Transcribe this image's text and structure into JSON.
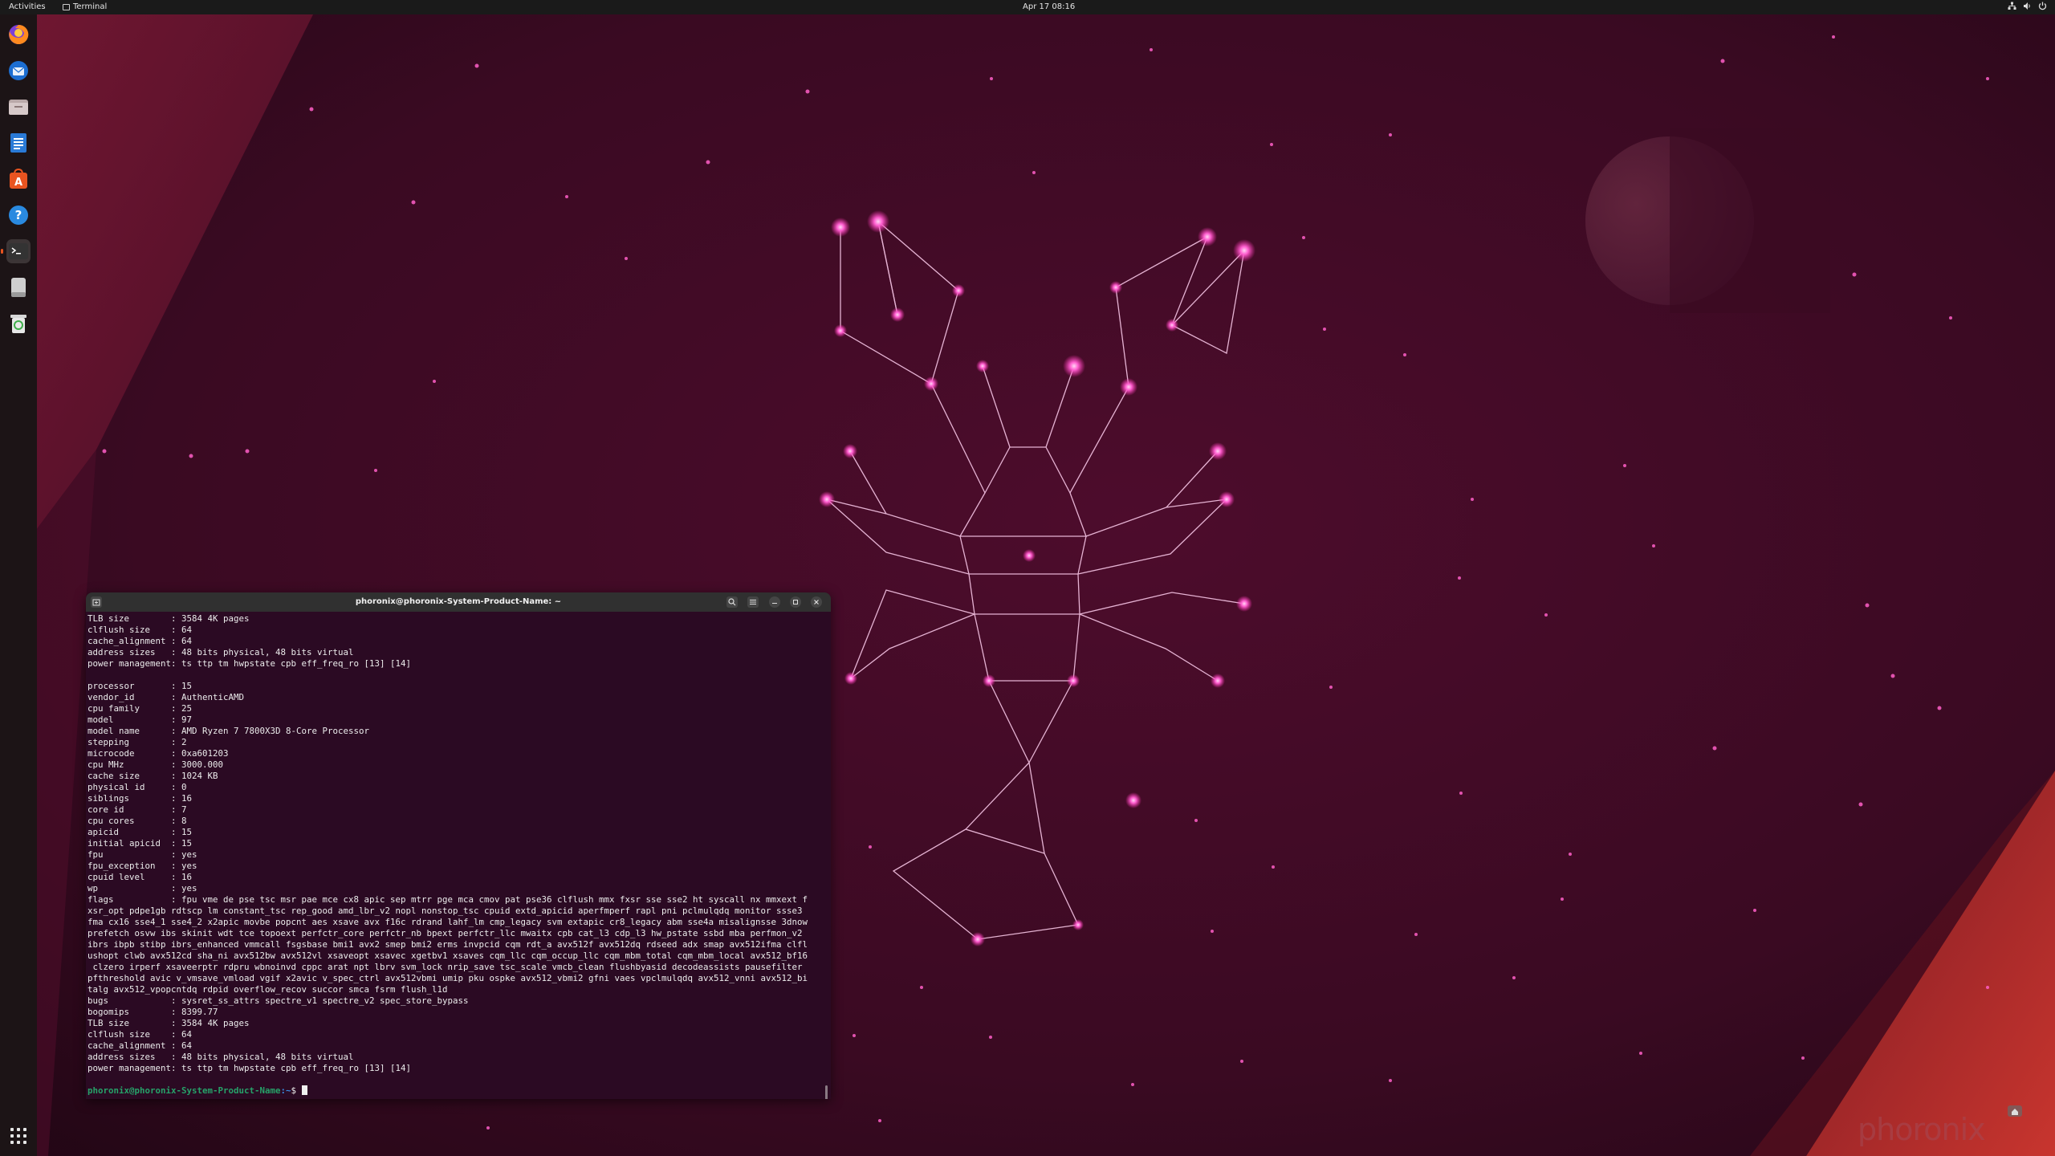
{
  "topbar": {
    "activities": "Activities",
    "app_name": "Terminal",
    "clock": "Apr 17  08:16"
  },
  "dock": {
    "items": [
      {
        "name": "firefox",
        "icon": "firefox-icon"
      },
      {
        "name": "thunderbird",
        "icon": "mail-icon"
      },
      {
        "name": "files",
        "icon": "folder-icon"
      },
      {
        "name": "writer",
        "icon": "document-icon"
      },
      {
        "name": "app-center",
        "icon": "store-icon"
      },
      {
        "name": "help",
        "icon": "help-icon"
      },
      {
        "name": "terminal",
        "icon": "terminal-icon",
        "active": true
      },
      {
        "name": "drive",
        "icon": "drive-icon"
      },
      {
        "name": "trash",
        "icon": "trash-icon"
      }
    ],
    "show_apps": "grid-icon"
  },
  "terminal": {
    "title": "phoronix@phoronix-System-Product-Name: ~",
    "lines": [
      "TLB size        : 3584 4K pages",
      "clflush size    : 64",
      "cache_alignment : 64",
      "address sizes   : 48 bits physical, 48 bits virtual",
      "power management: ts ttp tm hwpstate cpb eff_freq_ro [13] [14]",
      "",
      "processor       : 15",
      "vendor_id       : AuthenticAMD",
      "cpu family      : 25",
      "model           : 97",
      "model name      : AMD Ryzen 7 7800X3D 8-Core Processor",
      "stepping        : 2",
      "microcode       : 0xa601203",
      "cpu MHz         : 3000.000",
      "cache size      : 1024 KB",
      "physical id     : 0",
      "siblings        : 16",
      "core id         : 7",
      "cpu cores       : 8",
      "apicid          : 15",
      "initial apicid  : 15",
      "fpu             : yes",
      "fpu_exception   : yes",
      "cpuid level     : 16",
      "wp              : yes",
      "flags           : fpu vme de pse tsc msr pae mce cx8 apic sep mtrr pge mca cmov pat pse36 clflush mmx fxsr sse sse2 ht syscall nx mmxext f",
      "xsr_opt pdpe1gb rdtscp lm constant_tsc rep_good amd_lbr_v2 nopl nonstop_tsc cpuid extd_apicid aperfmperf rapl pni pclmulqdq monitor ssse3",
      "fma cx16 sse4_1 sse4_2 x2apic movbe popcnt aes xsave avx f16c rdrand lahf_lm cmp_legacy svm extapic cr8_legacy abm sse4a misalignsse 3dnow",
      "prefetch osvw ibs skinit wdt tce topoext perfctr_core perfctr_nb bpext perfctr_llc mwaitx cpb cat_l3 cdp_l3 hw_pstate ssbd mba perfmon_v2",
      "ibrs ibpb stibp ibrs_enhanced vmmcall fsgsbase bmi1 avx2 smep bmi2 erms invpcid cqm rdt_a avx512f avx512dq rdseed adx smap avx512ifma clfl",
      "ushopt clwb avx512cd sha_ni avx512bw avx512vl xsaveopt xsavec xgetbv1 xsaves cqm_llc cqm_occup_llc cqm_mbm_total cqm_mbm_local avx512_bf16",
      " clzero irperf xsaveerptr rdpru wbnoinvd cppc arat npt lbrv svm_lock nrip_save tsc_scale vmcb_clean flushbyasid decodeassists pausefilter",
      "pfthreshold avic v_vmsave_vmload vgif x2avic v_spec_ctrl avx512vbmi umip pku ospke avx512_vbmi2 gfni vaes vpclmulqdq avx512_vnni avx512_bi",
      "talg avx512_vpopcntdq rdpid overflow_recov succor smca fsrm flush_l1d",
      "bugs            : sysret_ss_attrs spectre_v1 spectre_v2 spec_store_bypass",
      "bogomips        : 8399.77",
      "TLB size        : 3584 4K pages",
      "clflush size    : 64",
      "cache_alignment : 64",
      "address sizes   : 48 bits physical, 48 bits virtual",
      "power management: ts ttp tm hwpstate cpb eff_freq_ro [13] [14]",
      ""
    ],
    "prompt_user": "phoronix@phoronix-System-Product-Name",
    "prompt_path": ":~",
    "prompt_symbol": "$"
  },
  "watermark": "phoronix",
  "colors": {
    "accent": "#e95420",
    "terminal_bg": "#2b0a23",
    "prompt_user": "#26a269",
    "wallpaper_dark": "#2d0718",
    "wallpaper_red": "#b3262e"
  }
}
